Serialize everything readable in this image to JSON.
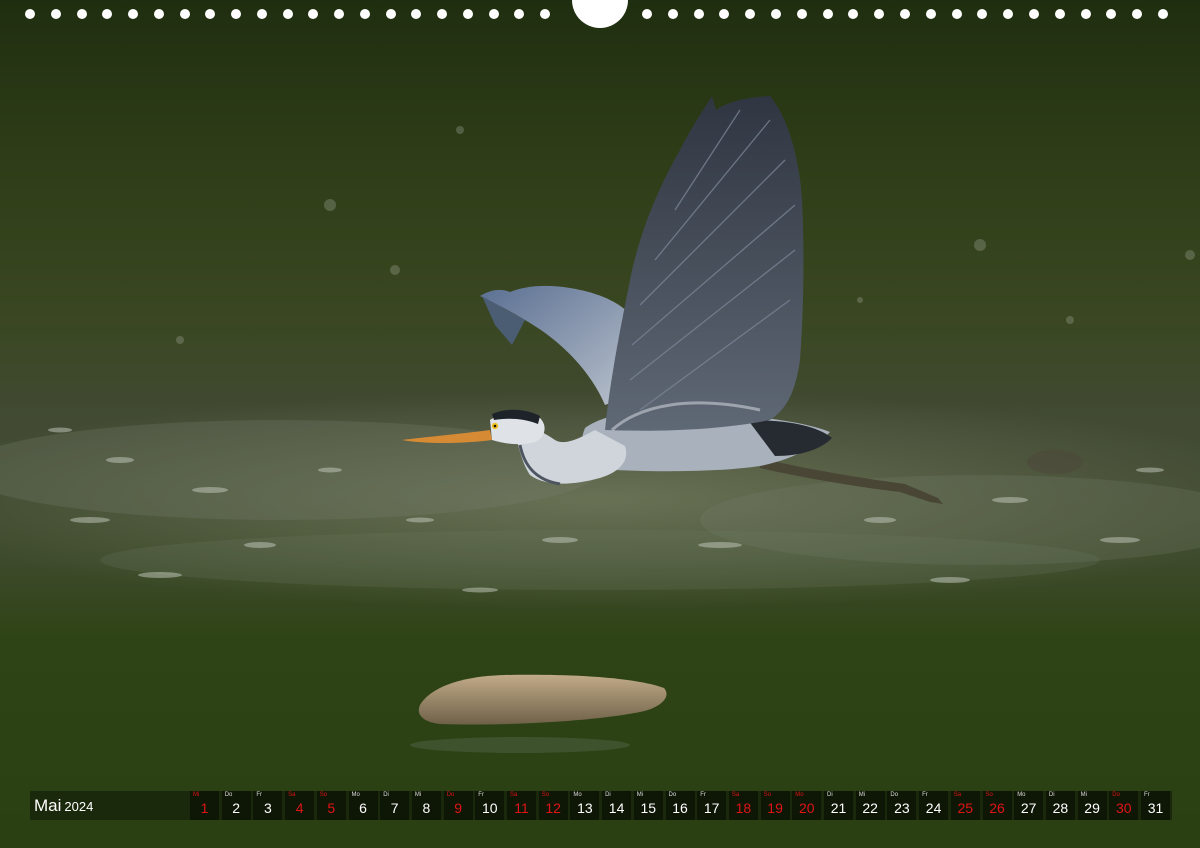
{
  "calendar": {
    "month": "Mai",
    "year": "2024",
    "colors": {
      "normal": "#ffffff",
      "holiday": "#e01414"
    },
    "days": [
      {
        "weekday": "Mi",
        "num": "1",
        "red": true
      },
      {
        "weekday": "Do",
        "num": "2",
        "red": false
      },
      {
        "weekday": "Fr",
        "num": "3",
        "red": false
      },
      {
        "weekday": "Sa",
        "num": "4",
        "red": true
      },
      {
        "weekday": "So",
        "num": "5",
        "red": true
      },
      {
        "weekday": "Mo",
        "num": "6",
        "red": false
      },
      {
        "weekday": "Di",
        "num": "7",
        "red": false
      },
      {
        "weekday": "Mi",
        "num": "8",
        "red": false
      },
      {
        "weekday": "Do",
        "num": "9",
        "red": true
      },
      {
        "weekday": "Fr",
        "num": "10",
        "red": false
      },
      {
        "weekday": "Sa",
        "num": "11",
        "red": true
      },
      {
        "weekday": "So",
        "num": "12",
        "red": true
      },
      {
        "weekday": "Mo",
        "num": "13",
        "red": false
      },
      {
        "weekday": "Di",
        "num": "14",
        "red": false
      },
      {
        "weekday": "Mi",
        "num": "15",
        "red": false
      },
      {
        "weekday": "Do",
        "num": "16",
        "red": false
      },
      {
        "weekday": "Fr",
        "num": "17",
        "red": false
      },
      {
        "weekday": "Sa",
        "num": "18",
        "red": true
      },
      {
        "weekday": "So",
        "num": "19",
        "red": true
      },
      {
        "weekday": "Mo",
        "num": "20",
        "red": true
      },
      {
        "weekday": "Di",
        "num": "21",
        "red": false
      },
      {
        "weekday": "Mi",
        "num": "22",
        "red": false
      },
      {
        "weekday": "Do",
        "num": "23",
        "red": false
      },
      {
        "weekday": "Fr",
        "num": "24",
        "red": false
      },
      {
        "weekday": "Sa",
        "num": "25",
        "red": true
      },
      {
        "weekday": "So",
        "num": "26",
        "red": true
      },
      {
        "weekday": "Mo",
        "num": "27",
        "red": false
      },
      {
        "weekday": "Di",
        "num": "28",
        "red": false
      },
      {
        "weekday": "Mi",
        "num": "29",
        "red": false
      },
      {
        "weekday": "Do",
        "num": "30",
        "red": true
      },
      {
        "weekday": "Fr",
        "num": "31",
        "red": false
      }
    ]
  }
}
